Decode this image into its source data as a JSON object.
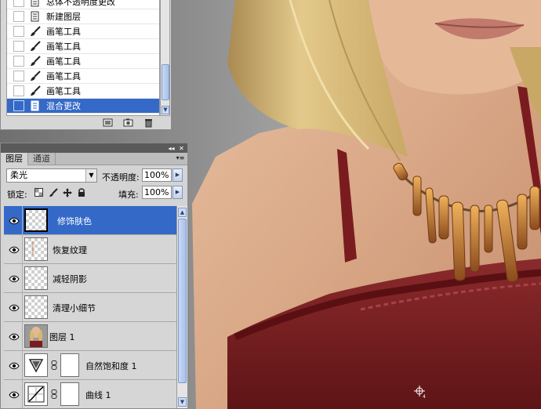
{
  "history": {
    "items": [
      {
        "label": "总体不透明度更改",
        "icon": "document-icon",
        "state": "normal"
      },
      {
        "label": "新建图层",
        "icon": "document-icon",
        "state": "normal"
      },
      {
        "label": "画笔工具",
        "icon": "brush-icon",
        "state": "normal"
      },
      {
        "label": "画笔工具",
        "icon": "brush-icon",
        "state": "normal"
      },
      {
        "label": "画笔工具",
        "icon": "brush-icon",
        "state": "normal"
      },
      {
        "label": "画笔工具",
        "icon": "brush-icon",
        "state": "normal"
      },
      {
        "label": "画笔工具",
        "icon": "brush-icon",
        "state": "normal"
      },
      {
        "label": "混合更改",
        "icon": "document-icon",
        "state": "active"
      }
    ],
    "footer_icons": [
      "new-document-from-state-icon",
      "new-snapshot-icon",
      "trash-icon"
    ]
  },
  "layers_panel": {
    "tabs": [
      {
        "label": "图层",
        "active": true
      },
      {
        "label": "通道",
        "active": false
      }
    ],
    "blend_mode": "柔光",
    "opacity_label": "不透明度:",
    "opacity_value": "100%",
    "lock_label": "锁定:",
    "fill_label": "填充:",
    "fill_value": "100%",
    "layers": [
      {
        "name": "修饰肤色",
        "type": "empty",
        "active": true
      },
      {
        "name": "恢复纹理",
        "type": "paint",
        "active": false
      },
      {
        "name": "减轻阴影",
        "type": "empty",
        "active": false
      },
      {
        "name": "清理小细节",
        "type": "empty",
        "active": false
      },
      {
        "name": "图层 1",
        "type": "photo",
        "active": false
      },
      {
        "name": "自然饱和度 1",
        "type": "vibrance",
        "active": false
      },
      {
        "name": "曲线 1",
        "type": "curves",
        "active": false
      }
    ]
  },
  "colors": {
    "selection": "#3469c8",
    "dress": "#7a1c1f",
    "skin": "#dcb08c",
    "hair": "#d7b872"
  }
}
